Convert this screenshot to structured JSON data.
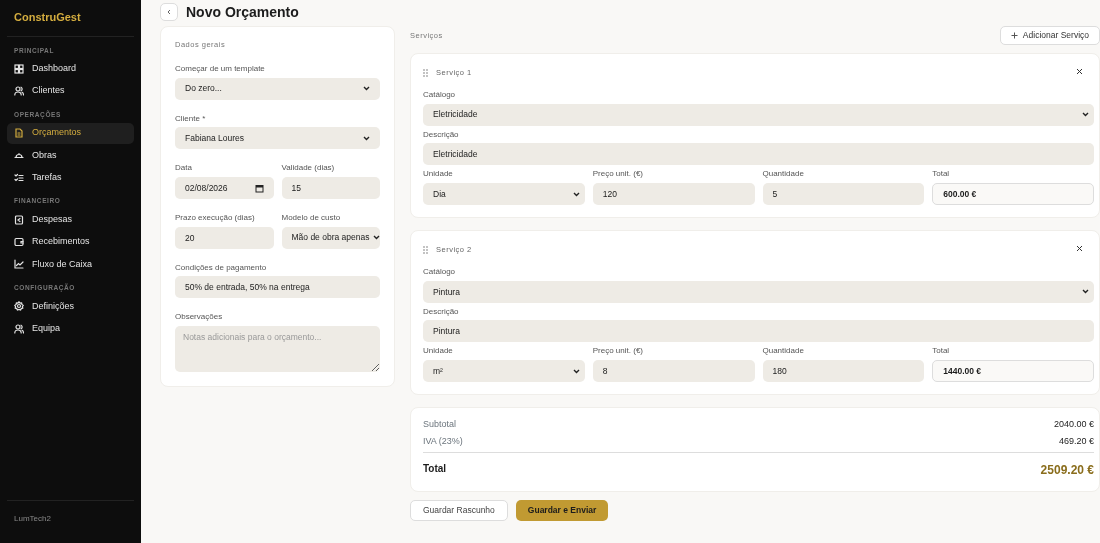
{
  "brand": "ConstruGest",
  "sidebar": {
    "sections": [
      {
        "title": "PRINCIPAL",
        "items": [
          {
            "label": "Dashboard",
            "selected": false
          },
          {
            "label": "Clientes",
            "selected": false
          }
        ]
      },
      {
        "title": "OPERAÇÕES",
        "items": [
          {
            "label": "Orçamentos",
            "selected": true
          },
          {
            "label": "Obras",
            "selected": false
          },
          {
            "label": "Tarefas",
            "selected": false
          }
        ]
      },
      {
        "title": "FINANCEIRO",
        "items": [
          {
            "label": "Despesas",
            "selected": false
          },
          {
            "label": "Recebimentos",
            "selected": false
          },
          {
            "label": "Fluxo de Caixa",
            "selected": false
          }
        ]
      },
      {
        "title": "CONFIGURAÇÃO",
        "items": [
          {
            "label": "Definições",
            "selected": false
          },
          {
            "label": "Equipa",
            "selected": false
          }
        ]
      }
    ],
    "footer": "LumTech2"
  },
  "header": {
    "title": "Novo Orçamento"
  },
  "general": {
    "title": "Dados gerais",
    "rows": [
      [
        {
          "label": "Começar de um template",
          "value": "Do zero...",
          "kind": "select"
        }
      ],
      [
        {
          "label": "Cliente *",
          "value": "Fabiana Loures",
          "kind": "select"
        }
      ],
      [
        {
          "label": "Data",
          "value": "02/08/2026",
          "kind": "date"
        },
        {
          "label": "Validade (dias)",
          "value": "15",
          "kind": "input"
        }
      ],
      [
        {
          "label": "Prazo execução (dias)",
          "value": "20",
          "kind": "input"
        },
        {
          "label": "Modelo de custo",
          "value": "Mão de obra apenas",
          "kind": "select"
        }
      ],
      [
        {
          "label": "Condições de pagamento",
          "value": "50% de entrada, 50% na entrega",
          "kind": "input"
        }
      ],
      [
        {
          "label": "Observações",
          "placeholder": "Notas adicionais para o orçamento...",
          "kind": "textarea"
        }
      ]
    ]
  },
  "services": {
    "title": "Serviços",
    "add_button": "Adicionar Serviço",
    "items": [
      {
        "name": "Serviço 1",
        "fields": [
          {
            "label": "Catálogo",
            "value": "Eletricidade",
            "kind": "select"
          },
          {
            "label": "Descrição",
            "value": "Eletricidade",
            "kind": "input"
          }
        ],
        "columns": [
          {
            "label": "Unidade",
            "value": "Dia",
            "kind": "select"
          },
          {
            "label": "Preço unit. (€)",
            "value": "120",
            "kind": "input"
          },
          {
            "label": "Quantidade",
            "value": "5",
            "kind": "input"
          },
          {
            "label": "Total",
            "value": "600.00 €",
            "kind": "total"
          }
        ]
      },
      {
        "name": "Serviço 2",
        "fields": [
          {
            "label": "Catálogo",
            "value": "Pintura",
            "kind": "select"
          },
          {
            "label": "Descrição",
            "value": "Pintura",
            "kind": "input"
          }
        ],
        "columns": [
          {
            "label": "Unidade",
            "value": "m²",
            "kind": "select"
          },
          {
            "label": "Preço unit. (€)",
            "value": "8",
            "kind": "input"
          },
          {
            "label": "Quantidade",
            "value": "180",
            "kind": "input"
          },
          {
            "label": "Total",
            "value": "1440.00 €",
            "kind": "total"
          }
        ]
      }
    ]
  },
  "totals": [
    {
      "label": "Subtotal",
      "value": "2040.00 €",
      "kind": "sub"
    },
    {
      "label": "IVA (23%)",
      "value": "469.20 €",
      "kind": "sub"
    },
    {
      "label": "Total",
      "value": "2509.20 €",
      "kind": "grand"
    }
  ],
  "actions": [
    {
      "label": "Guardar Rascunho",
      "kind": "secondary"
    },
    {
      "label": "Guardar e Enviar",
      "kind": "primary"
    }
  ]
}
